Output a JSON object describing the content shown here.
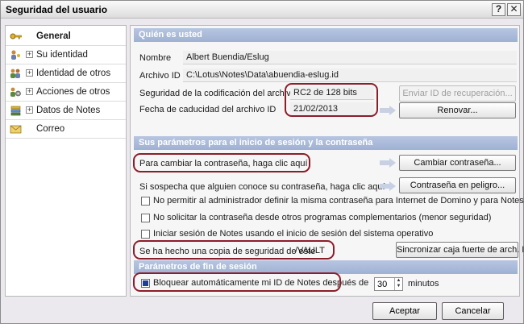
{
  "window": {
    "title": "Seguridad del usuario",
    "help": "?",
    "close": "✕"
  },
  "sidebar": {
    "items": [
      {
        "label": "General",
        "icon": "key-icon",
        "active": true,
        "expandable": false
      },
      {
        "label": "Su identidad",
        "icon": "person-key-icon",
        "active": false,
        "expandable": true
      },
      {
        "label": "Identidad de otros",
        "icon": "people-icon",
        "active": false,
        "expandable": true
      },
      {
        "label": "Acciones de otros",
        "icon": "people-gear-icon",
        "active": false,
        "expandable": true
      },
      {
        "label": "Datos de Notes",
        "icon": "stack-icon",
        "active": false,
        "expandable": true
      },
      {
        "label": "Correo",
        "icon": "mail-icon",
        "active": false,
        "expandable": false
      }
    ]
  },
  "identity": {
    "header": "Quién es usted",
    "name_label": "Nombre",
    "name_value": "Albert Buendia/Eslug",
    "file_label": "Archivo ID",
    "file_value": "C:\\Lotus\\Notes\\Data\\abuendia-eslug.id",
    "encryption_label": "Seguridad de la codificación del archivo ID",
    "encryption_value": "RC2 de 128 bits",
    "expiry_label": "Fecha de caducidad del archivo ID",
    "expiry_value": "21/02/2013",
    "recovery_button": "Enviar ID de recuperación...",
    "renew_button": "Renovar..."
  },
  "login": {
    "header": "Sus parámetros para el inicio de sesión y la contraseña",
    "change_text": "Para cambiar la contraseña, haga clic aquí",
    "change_button": "Cambiar contraseña...",
    "danger_text": "Si sospecha que alguien conoce su contraseña, haga clic aquí",
    "danger_button": "Contraseña en peligro...",
    "opt1": "No permitir al administrador definir la misma contraseña para Internet de Domino y para Notes",
    "opt2": "No solicitar la contraseña desde otros programas complementarios (menor seguridad)",
    "opt3": "Iniciar sesión de Notes usando el inicio de sesión del sistema operativo",
    "backup_text": "Se ha hecho una copia de seguridad de este",
    "backup_value": "/VAULT",
    "sync_button": "Sincronizar caja fuerte de arch. ID"
  },
  "session_end": {
    "header": "Parámetros de fin de sesión",
    "lock_label": "Bloquear automáticamente mi ID de Notes después de",
    "lock_checked": true,
    "minutes_value": "30",
    "minutes_label": "minutos"
  },
  "footer": {
    "accept": "Aceptar",
    "cancel": "Cancelar"
  },
  "colors": {
    "section_header": "#a8b8d8",
    "highlight": "#8c1d2a",
    "arrow": "#c8d0e4"
  }
}
